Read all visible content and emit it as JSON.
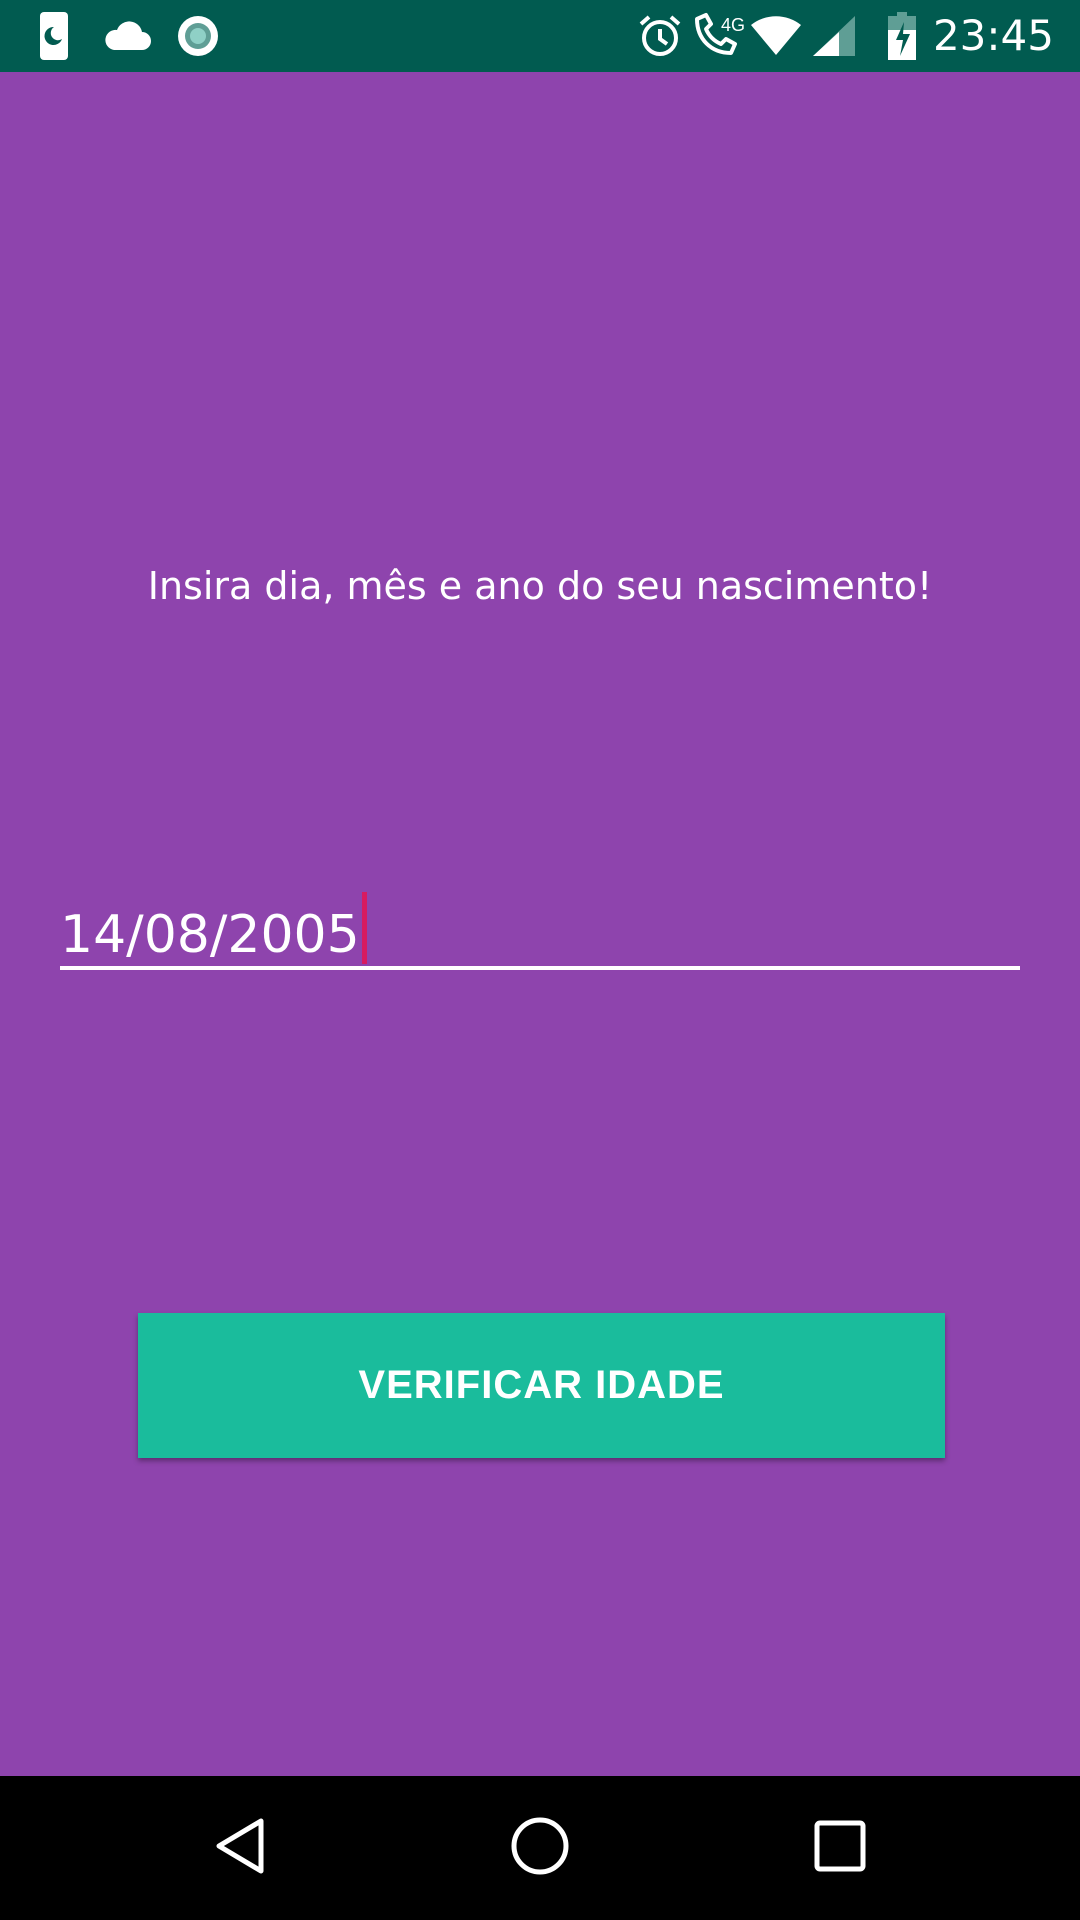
{
  "status_bar": {
    "time": "23:45",
    "background_color": "#015b50",
    "left_icons": [
      "phone-moon-icon",
      "cloud-icon",
      "record-icon"
    ],
    "right_icons": [
      "alarm-icon",
      "call-4g-icon",
      "wifi-icon",
      "signal-icon",
      "battery-charging-icon"
    ],
    "network_label": "4G"
  },
  "main": {
    "background_color": "#8e44ad",
    "prompt": "Insira dia, mês e ano do seu nascimento!",
    "date_input": {
      "value": "14/08/2005",
      "cursor_color": "#d81b60"
    },
    "verify_button": {
      "label": "VERIFICAR IDADE",
      "color": "#1abc9c"
    }
  },
  "nav_bar": {
    "buttons": [
      "back-icon",
      "home-icon",
      "recents-icon"
    ]
  }
}
